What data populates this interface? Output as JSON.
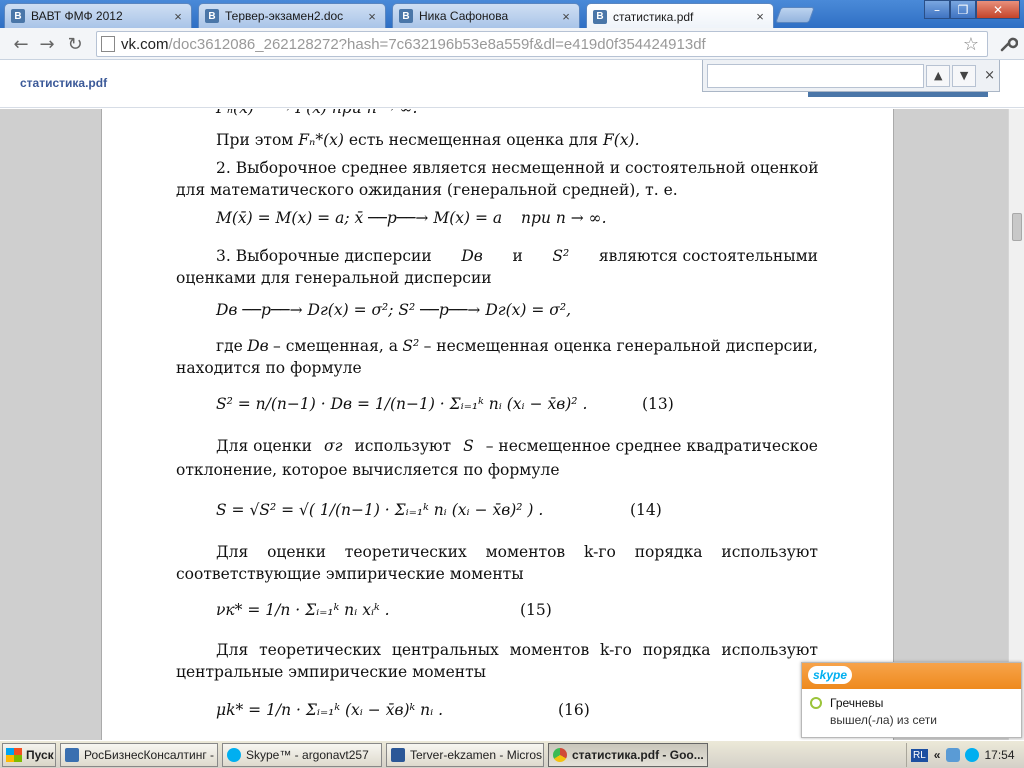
{
  "tabs": [
    {
      "icon": "В",
      "label": "ВАВТ ФМФ 2012",
      "close": "×"
    },
    {
      "icon": "В",
      "label": "Тервер-экзамен2.doc",
      "close": "×"
    },
    {
      "icon": "В",
      "label": "Ника Сафонова",
      "close": "×"
    },
    {
      "icon": "В",
      "label": "статистика.pdf",
      "close": "×",
      "active": true
    }
  ],
  "window": {
    "minimize": "–",
    "maximize": "❐",
    "close": "✕"
  },
  "nav": {
    "back": "←",
    "forward": "→",
    "reload": "↻"
  },
  "address": {
    "host": "vk.com",
    "path": "/doc3612086_262128272?hash=7c632196b53e8a559f&dl=e419d0f354424913df"
  },
  "viewer": {
    "doc_title": "статистика.pdf"
  },
  "find": {
    "value": "",
    "prev": "▲",
    "next": "▼",
    "close": "×"
  },
  "doc": {
    "l0": "Fₙ(x) ──→ F(x) при n → ∞.",
    "l1a": "При этом",
    "l1b": "Fₙ*(x)",
    "l1c": "есть несмещенная оценка для",
    "l1d": "F(x).",
    "l2": "2. Выборочное среднее является несмещенной и состоятельной оценкой",
    "l3": "для математического ожидания (генеральной средней), т. е.",
    "f1": "M(x̄) = M(x) = a;   x̄ ──p──→ M(x) = a",
    "f1b": "при n → ∞.",
    "l4a": "3. Выборочные дисперсии",
    "l4b": "Dв",
    "l4c": "и",
    "l4d": "S²",
    "l4e": "являются состоятельными",
    "l5": "оценками для генеральной дисперсии",
    "f2": "Dв ──p──→ Dг(x) = σ²;   S² ──p──→ Dг(x) = σ²,",
    "l6a": "где",
    "l6b": "Dв",
    "l6c": "– смещенная, а",
    "l6d": "S²",
    "l6e": "– несмещенная оценка генеральной дисперсии,",
    "l7": "находится по формуле",
    "f3": "S² = n/(n−1) · Dв = 1/(n−1) · Σᵢ₌₁ᵏ nᵢ (xᵢ − x̄в)² .",
    "n13": "(13)",
    "l8a": "Для оценки",
    "l8b": "σг",
    "l8c": "используют",
    "l8d": "S",
    "l8e": "– несмещенное среднее квадратическое",
    "l9": "отклонение, которое вычисляется по формуле",
    "f4": "S = √S² = √( 1/(n−1) · Σᵢ₌₁ᵏ nᵢ (xᵢ − x̄в)² ) .",
    "n14": "(14)",
    "l10": "Для оценки теоретических моментов k-го порядка используют",
    "l11": "соответствующие эмпирические моменты",
    "f5": "νк* = 1/n · Σᵢ₌₁ᵏ nᵢ xᵢᵏ .",
    "n15": "(15)",
    "l12": "Для теоретических центральных моментов k-го порядка используют",
    "l13": "центральные эмпирические моменты",
    "f6": "μk* = 1/n · Σᵢ₌₁ᵏ (xᵢ − x̄в)ᵏ nᵢ .",
    "n16": "(16)"
  },
  "skype_popup": {
    "logo": "skype",
    "name": "Гречневы",
    "status": "вышел(-ла) из сети"
  },
  "taskbar": {
    "start": "Пуск",
    "items": [
      {
        "label": "РосБизнесКонсалтинг - ...",
        "color": "#3a6fb0"
      },
      {
        "label": "Skype™ - argonavt257",
        "color": "#00aff0"
      },
      {
        "label": "Terver-ekzamen - Micros...",
        "color": "#2b5797"
      },
      {
        "label": "статистика.pdf - Goo...",
        "color": "#d04a38",
        "active": true
      }
    ],
    "lang": "RL",
    "chevron": "«",
    "time": "17:54"
  }
}
